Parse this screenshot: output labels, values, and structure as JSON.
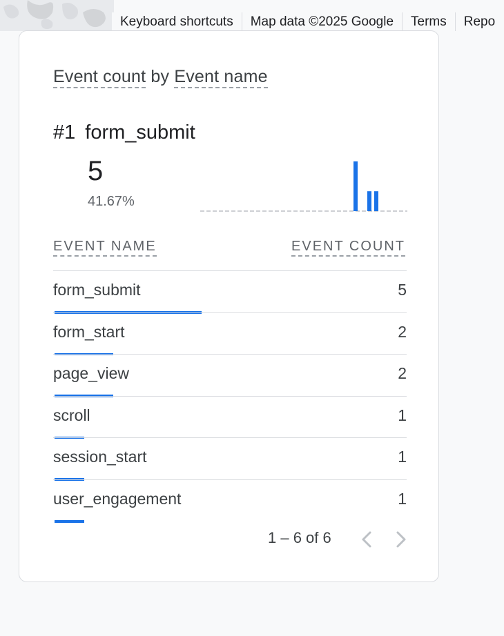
{
  "map_attribution": {
    "keyboard_shortcuts": "Keyboard shortcuts",
    "map_data": "Map data ©2025 Google",
    "terms": "Terms",
    "report": "Repo"
  },
  "card": {
    "title_metric": "Event count",
    "title_by": "by",
    "title_dimension": "Event name",
    "top_rank": "#1",
    "top_name": "form_submit",
    "top_value": "5",
    "top_percent": "41.67%",
    "sparkline_values": [
      0,
      0,
      0,
      0,
      0,
      0,
      0,
      0,
      0,
      0,
      0,
      0,
      0,
      0,
      0,
      0,
      0,
      0,
      0,
      0,
      0,
      0,
      5,
      0,
      2,
      2,
      0,
      0,
      0,
      0
    ],
    "accent_color": "#1a73e8",
    "columns": {
      "name": "EVENT NAME",
      "count": "EVENT COUNT"
    },
    "rows": [
      {
        "name": "form_submit",
        "count": "5",
        "share": 0.4167
      },
      {
        "name": "form_start",
        "count": "2",
        "share": 0.1667
      },
      {
        "name": "page_view",
        "count": "2",
        "share": 0.1667
      },
      {
        "name": "scroll",
        "count": "1",
        "share": 0.0833
      },
      {
        "name": "session_start",
        "count": "1",
        "share": 0.0833
      },
      {
        "name": "user_engagement",
        "count": "1",
        "share": 0.0833
      }
    ],
    "pagination": "1 – 6 of 6"
  }
}
